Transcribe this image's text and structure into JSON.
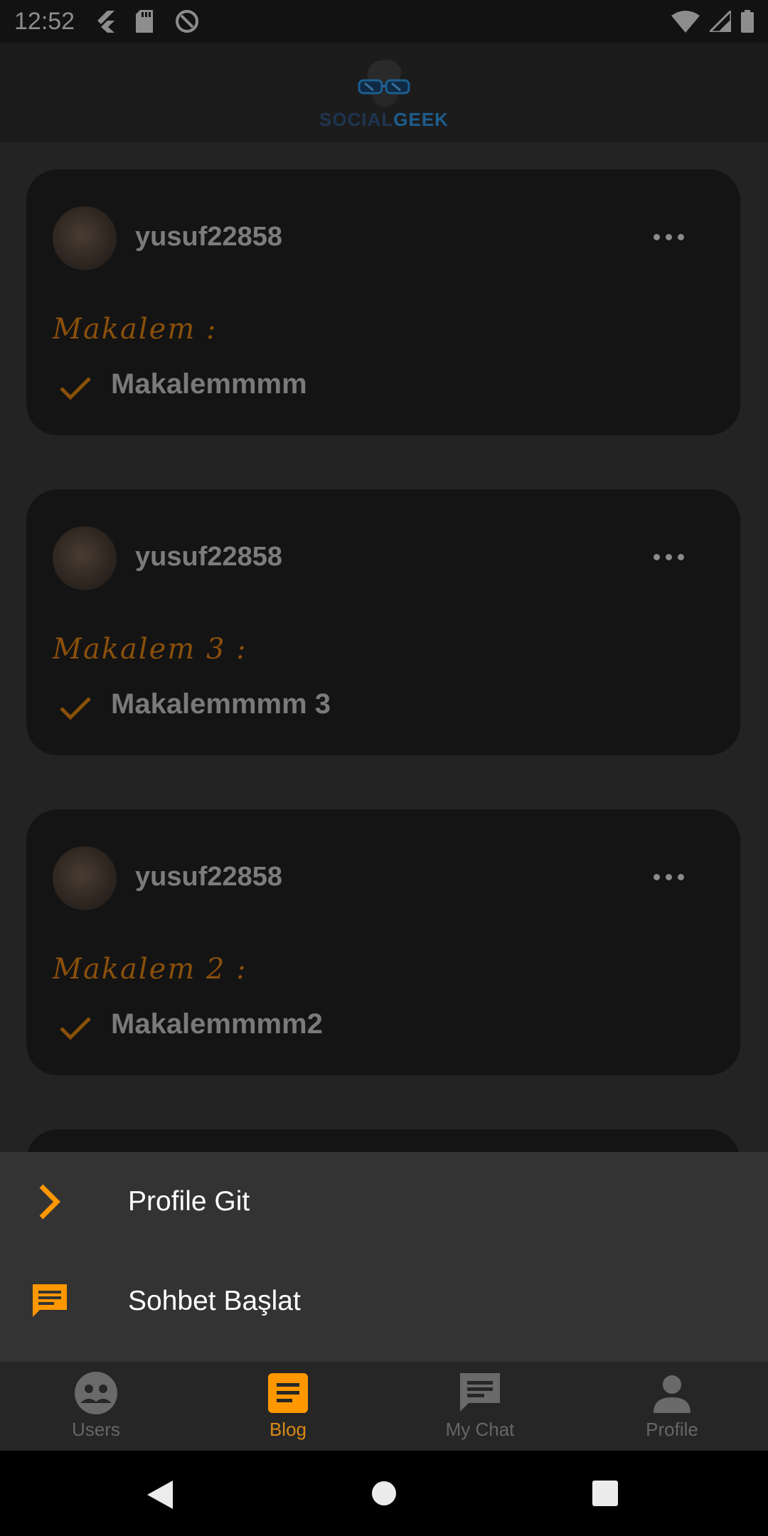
{
  "status_bar": {
    "time": "12:52"
  },
  "app_bar": {
    "logo_part1": "SOCIAL",
    "logo_part2": "GEEK"
  },
  "posts": [
    {
      "username": "yusuf22858",
      "title": "Makalem :",
      "body": "Makalemmmm"
    },
    {
      "username": "yusuf22858",
      "title": "Makalem 3 :",
      "body": "Makalemmmm 3"
    },
    {
      "username": "yusuf22858",
      "title": "Makalem 2 :",
      "body": "Makalemmmm2"
    }
  ],
  "bottom_sheet": {
    "items": [
      {
        "label": "Profile Git",
        "icon": "chevron-right-icon"
      },
      {
        "label": "Sohbet Başlat",
        "icon": "chat-icon"
      }
    ]
  },
  "bottom_nav": {
    "items": [
      {
        "label": "Users",
        "icon": "users-icon",
        "active": false
      },
      {
        "label": "Blog",
        "icon": "article-icon",
        "active": true
      },
      {
        "label": "My Chat",
        "icon": "chat-bubble-icon",
        "active": false
      },
      {
        "label": "Profile",
        "icon": "person-icon",
        "active": false
      }
    ]
  },
  "colors": {
    "accent": "#ff9800",
    "background": "#2b2b2b",
    "card": "#141414",
    "sheet": "#333333"
  }
}
